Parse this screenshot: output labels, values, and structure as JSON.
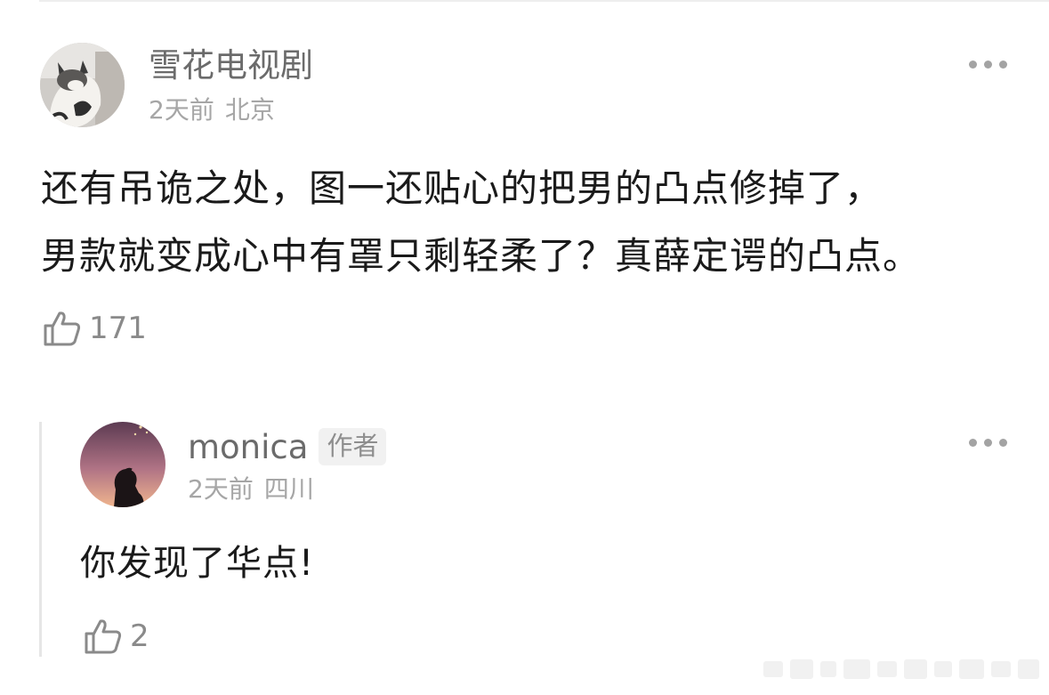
{
  "comment": {
    "username": "雪花电视剧",
    "time": "2天前",
    "location": "北京",
    "text_line1": "还有吊诡之处，图一还贴心的把男的凸点修掉了，",
    "text_line2": "男款就变成心中有罩只剩轻柔了？真薛定谔的凸点。",
    "likes": "171"
  },
  "reply": {
    "username": "monica",
    "author_badge": "作者",
    "time": "2天前",
    "location": "四川",
    "text": "你发现了华点!",
    "likes": "2"
  },
  "icons": {
    "more": "more-dots-icon",
    "like": "thumbs-up-icon"
  },
  "colors": {
    "text": "#1a1a1a",
    "username": "#6b6b6b",
    "meta": "#a6a6a6",
    "icon": "#8a8a8a"
  }
}
